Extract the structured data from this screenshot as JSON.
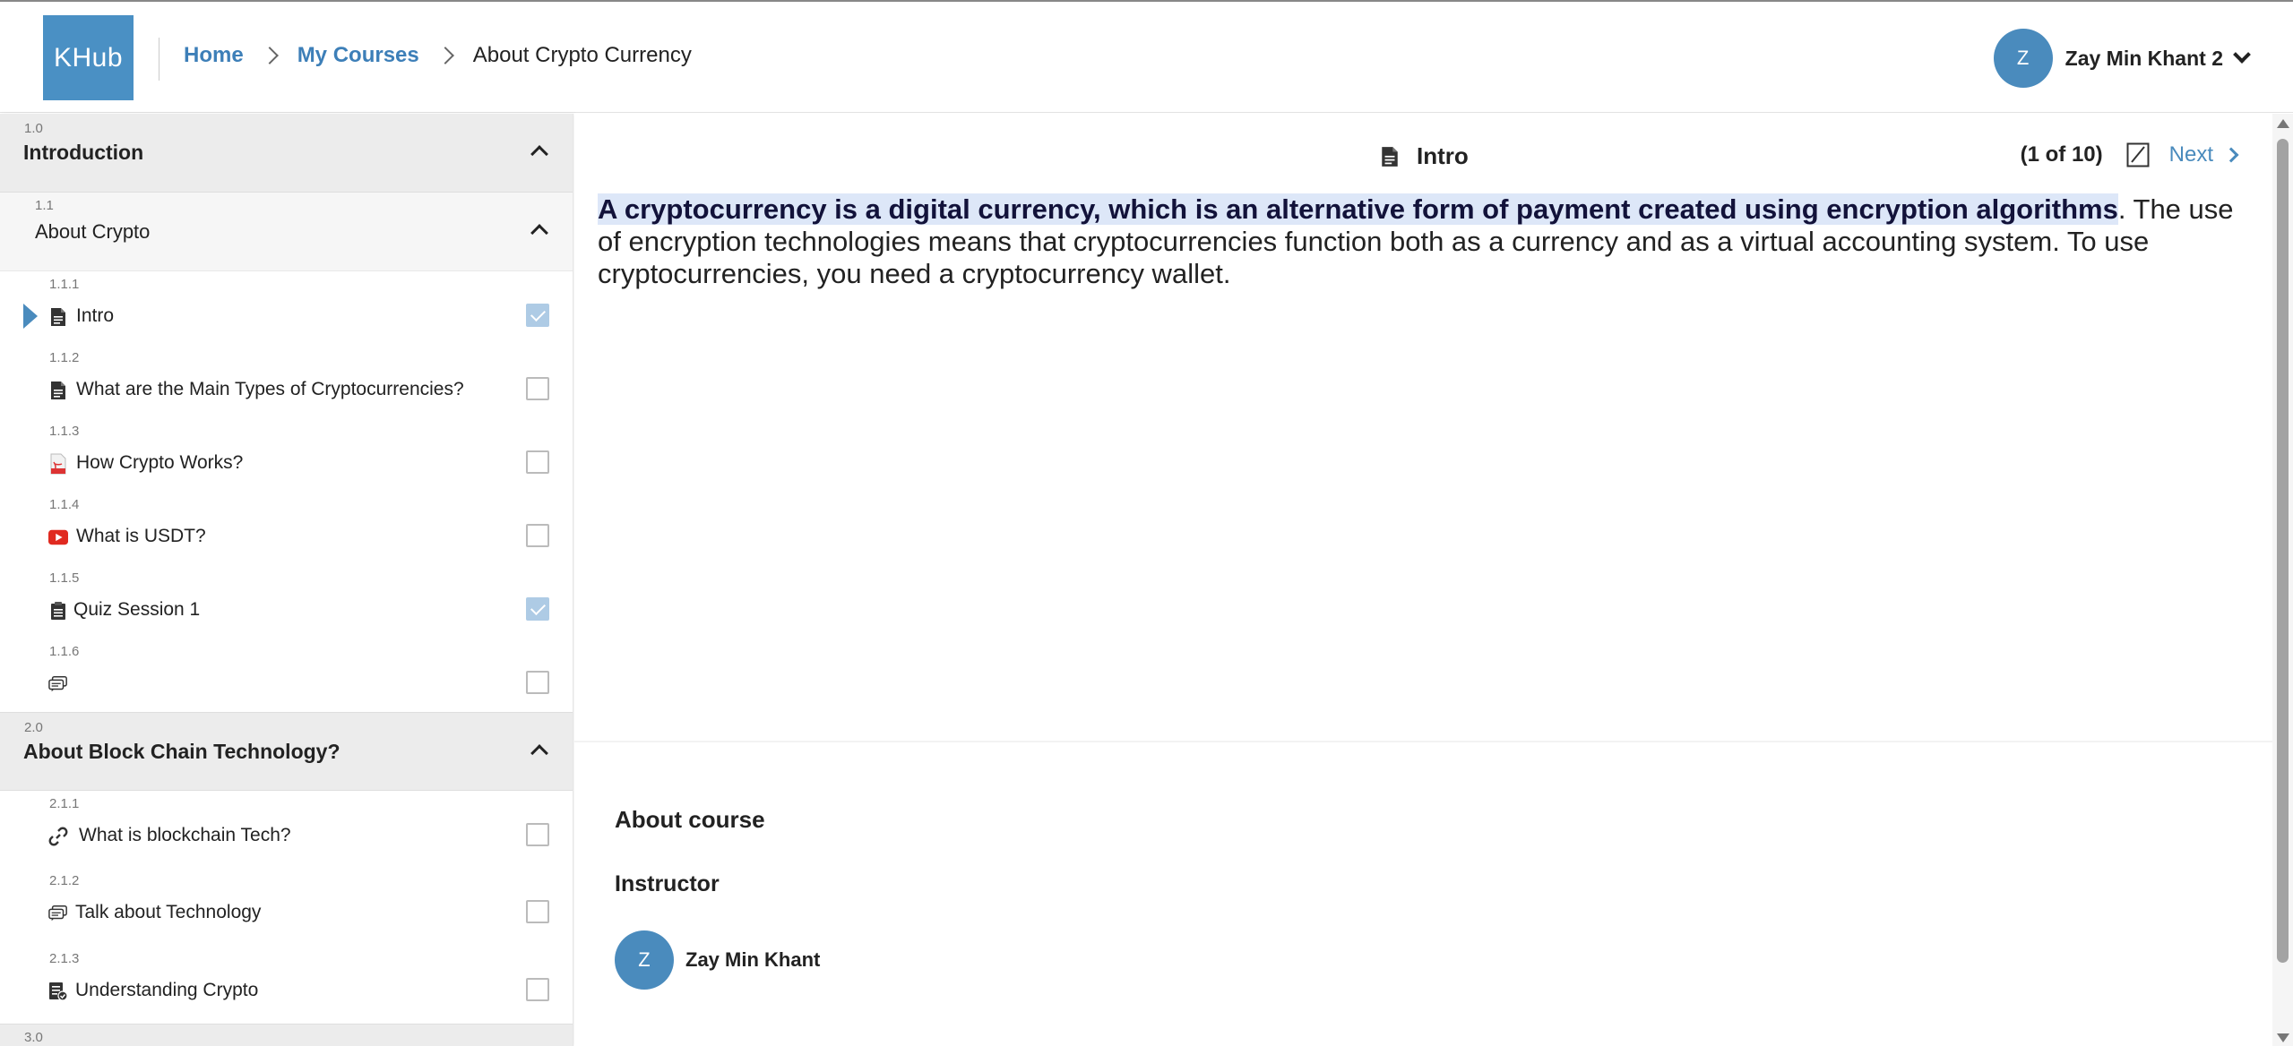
{
  "header": {
    "logo": "KHub",
    "breadcrumb": {
      "home": "Home",
      "my_courses": "My Courses",
      "current": "About Crypto Currency"
    },
    "user": {
      "initial": "Z",
      "name": "Zay Min Khant 2"
    }
  },
  "sidebar": {
    "section1": {
      "number": "1.0",
      "title": "Introduction"
    },
    "sub1": {
      "number": "1.1",
      "title": "About Crypto"
    },
    "items1": [
      {
        "number": "1.1.1",
        "label": "Intro",
        "icon": "document-icon",
        "checked": true,
        "active": true
      },
      {
        "number": "1.1.2",
        "label": "What are the Main Types of Cryptocurrencies?",
        "icon": "document-icon",
        "checked": false
      },
      {
        "number": "1.1.3",
        "label": "How Crypto Works?",
        "icon": "pdf-icon",
        "checked": false
      },
      {
        "number": "1.1.4",
        "label": "What is USDT?",
        "icon": "youtube-icon",
        "checked": false
      },
      {
        "number": "1.1.5",
        "label": "Quiz Session 1",
        "icon": "clipboard-icon",
        "checked": true
      },
      {
        "number": "1.1.6",
        "label": "",
        "icon": "discussion-icon",
        "checked": false
      }
    ],
    "section2": {
      "number": "2.0",
      "title": "About Block Chain Technology?"
    },
    "items2": [
      {
        "number": "2.1.1",
        "label": "What is blockchain Tech?",
        "icon": "link-icon",
        "checked": false
      },
      {
        "number": "2.1.2",
        "label": "Talk about Technology",
        "icon": "discussion-icon",
        "checked": false
      },
      {
        "number": "2.1.3",
        "label": "Understanding Crypto",
        "icon": "assignment-icon",
        "checked": false
      }
    ],
    "section3": {
      "number": "3.0"
    }
  },
  "main": {
    "title": "Intro",
    "pager": {
      "count": "(1 of 10)",
      "next": "Next"
    },
    "article": {
      "highlight": "A cryptocurrency is a digital currency, which is an alternative form of payment created using encryption algorithms",
      "rest": ". The use of encryption technologies means that cryptocurrencies function both as a currency and as a virtual accounting system. To use cryptocurrencies, you need a cryptocurrency wallet."
    },
    "about_course": "About course",
    "instructor_heading": "Instructor",
    "instructor": {
      "initial": "Z",
      "name": "Zay Min Khant"
    }
  },
  "colors": {
    "brand": "#4a90c4",
    "link": "#3d7fb8",
    "highlight": "#dde7f8",
    "checked": "#aecbe5"
  }
}
